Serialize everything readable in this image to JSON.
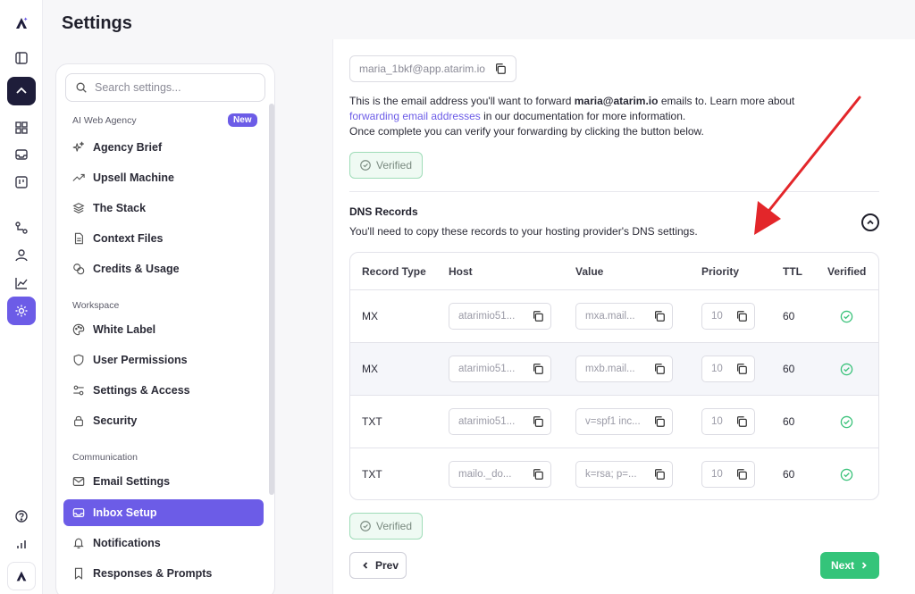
{
  "header": {
    "title": "Settings"
  },
  "rail": {
    "icons": [
      "app-logo-icon",
      "panel-toggle-icon",
      "home-icon",
      "grid-icon",
      "inbox-icon",
      "board-icon",
      "flow-icon",
      "user-icon",
      "chart-icon",
      "settings-icon",
      "help-icon",
      "stats-icon",
      "brand-icon"
    ]
  },
  "sidebar": {
    "search_placeholder": "Search settings...",
    "section_ai": "AI Web Agency",
    "new_badge": "New",
    "section_workspace": "Workspace",
    "section_communication": "Communication",
    "items": [
      {
        "label": "Agency Brief",
        "icon": "sparkle-icon"
      },
      {
        "label": "Upsell Machine",
        "icon": "trend-up-icon"
      },
      {
        "label": "The Stack",
        "icon": "layers-icon"
      },
      {
        "label": "Context Files",
        "icon": "file-icon"
      },
      {
        "label": "Credits & Usage",
        "icon": "coins-icon"
      },
      {
        "label": "White Label",
        "icon": "palette-icon"
      },
      {
        "label": "User Permissions",
        "icon": "shield-icon"
      },
      {
        "label": "Settings & Access",
        "icon": "sliders-icon"
      },
      {
        "label": "Security",
        "icon": "lock-icon"
      },
      {
        "label": "Email Settings",
        "icon": "mail-icon"
      },
      {
        "label": "Inbox Setup",
        "icon": "inbox-icon"
      },
      {
        "label": "Notifications",
        "icon": "bell-icon"
      },
      {
        "label": "Responses & Prompts",
        "icon": "bookmark-icon"
      }
    ]
  },
  "main": {
    "forward_email": "maria_1bkf@app.atarim.io",
    "info_line1_pre": "This is the email address you'll want to forward ",
    "info_line1_bold": "maria@atarim.io",
    "info_line1_post": " emails to. Learn more about",
    "info_link": "forwarding email addresses",
    "info_line2_post": " in our documentation for more information.",
    "info_line3": "Once complete you can verify your forwarding by clicking the button below.",
    "verified_label": "Verified",
    "dns_title": "DNS Records",
    "dns_subtitle": "You'll need to copy these records to your hosting provider's DNS settings.",
    "columns": [
      "Record Type",
      "Host",
      "Value",
      "Priority",
      "TTL",
      "Verified"
    ],
    "records": [
      {
        "type": "MX",
        "host": "atarimio51...",
        "value": "mxa.mail...",
        "priority": "10",
        "ttl": "60",
        "verified": true
      },
      {
        "type": "MX",
        "host": "atarimio51...",
        "value": "mxb.mail...",
        "priority": "10",
        "ttl": "60",
        "verified": true
      },
      {
        "type": "TXT",
        "host": "atarimio51...",
        "value": "v=spf1 inc...",
        "priority": "10",
        "ttl": "60",
        "verified": true
      },
      {
        "type": "TXT",
        "host": "mailo._do...",
        "value": "k=rsa; p=...",
        "priority": "10",
        "ttl": "60",
        "verified": true
      }
    ],
    "verified_bottom_label": "Verified",
    "prev_label": "Prev",
    "next_label": "Next"
  },
  "colors": {
    "accent": "#6c5ce7",
    "success": "#34c47a",
    "arrow": "#e3262a"
  }
}
